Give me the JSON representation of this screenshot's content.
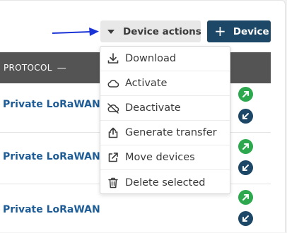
{
  "toolbar": {
    "device_actions_label": "Device actions",
    "add_device_label": "Device",
    "add_device_symbol": "+"
  },
  "table": {
    "header": {
      "protocol_label": "PROTOCOL",
      "sort_symbol": "—"
    },
    "rows": [
      {
        "protocol": "Private LoRaWAN"
      },
      {
        "protocol": "Private LoRaWAN"
      },
      {
        "protocol": "Private LoRaWAN"
      }
    ]
  },
  "menu": {
    "items": [
      {
        "label": "Download",
        "icon": "download-icon"
      },
      {
        "label": "Activate",
        "icon": "cloud-icon"
      },
      {
        "label": "Deactivate",
        "icon": "cloud-off-icon"
      },
      {
        "label": "Generate transfer",
        "icon": "share-upload-icon"
      },
      {
        "label": "Move devices",
        "icon": "external-link-icon"
      },
      {
        "label": "Delete selected",
        "icon": "trash-icon"
      }
    ]
  },
  "colors": {
    "primary": "#1c4766",
    "link": "#1d5c96",
    "success": "#2ea84e",
    "annotation_arrow": "#1a33d6",
    "table_header": "#545454"
  }
}
